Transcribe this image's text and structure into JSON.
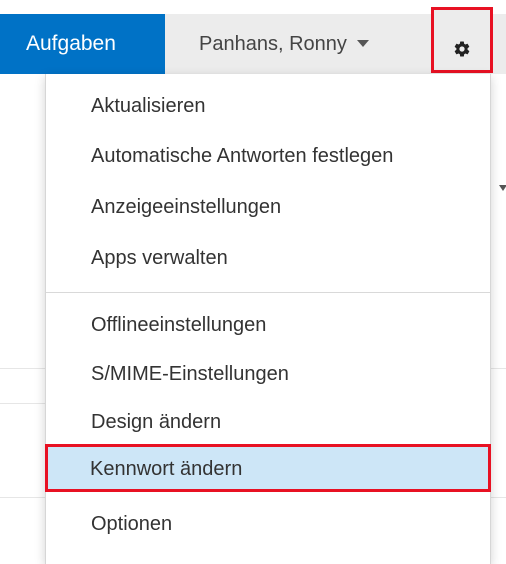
{
  "header": {
    "tab_label": "Aufgaben",
    "user_name": "Panhans, Ronny",
    "settings_icon": "gear-icon"
  },
  "colors": {
    "accent": "#0072c6",
    "highlight_bg": "#cde6f7",
    "annotation_red": "#e81123",
    "header_bg": "#ececec"
  },
  "settings_menu": {
    "items": [
      {
        "label": "Aktualisieren"
      },
      {
        "label": "Automatische Antworten festlegen"
      },
      {
        "label": "Anzeigeeinstellungen"
      },
      {
        "label": "Apps verwalten"
      },
      {
        "label": "Offlineeinstellungen"
      },
      {
        "label": "S/MIME-Einstellungen"
      },
      {
        "label": "Design ändern"
      },
      {
        "label": "Kennwort ändern"
      },
      {
        "label": "Optionen"
      }
    ],
    "highlighted_item": "Kennwort ändern"
  }
}
